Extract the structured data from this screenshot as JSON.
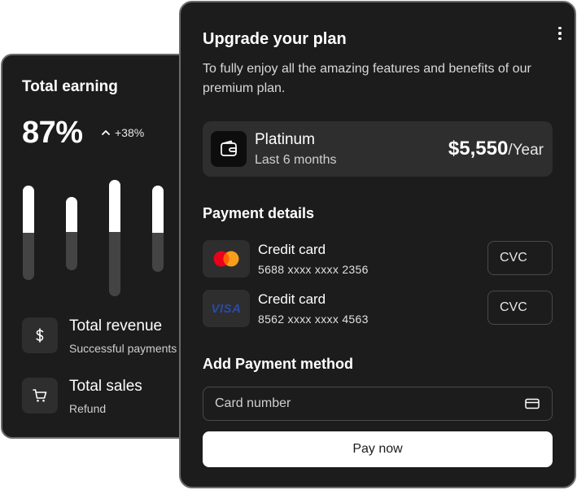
{
  "earnings": {
    "title": "Total earning",
    "percent": "87%",
    "change": "+38%",
    "bars": [
      {
        "level": 0.5
      },
      {
        "level": 0.48
      },
      {
        "level": 0.45
      },
      {
        "level": 0.55
      }
    ],
    "rows": [
      {
        "icon": "dollar-icon",
        "name": "Total revenue",
        "sub": "Successful payments"
      },
      {
        "icon": "cart-icon",
        "name": "Total sales",
        "sub": "Refund"
      }
    ]
  },
  "upgrade": {
    "title": "Upgrade your plan",
    "description": "To fully enjoy all the amazing features and benefits of our premium plan.",
    "menu_icon": "more-vertical-icon",
    "plan": {
      "icon": "wallet-icon",
      "name": "Platinum",
      "period": "Last 6 months",
      "amount": "$5,550",
      "unit": "/Year"
    },
    "payment_details_title": "Payment details",
    "methods": [
      {
        "brand": "mastercard",
        "name": "Credit card",
        "number": "5688 xxxx xxxx 2356",
        "cvc_placeholder": "CVC"
      },
      {
        "brand": "visa",
        "brand_label": "VISA",
        "name": "Credit card",
        "number": "8562 xxxx xxxx 4563",
        "cvc_placeholder": "CVC"
      }
    ],
    "add_method_title": "Add Payment method",
    "card_number_placeholder": "Card number",
    "pay_button": "Pay now"
  },
  "colors": {
    "card_bg": "#1c1c1c",
    "panel_bg": "#2e2e2e",
    "border": "#6b6b6b",
    "accent": "#ffffff",
    "mastercard_red": "#eb001b",
    "mastercard_orange": "#f79e1b"
  }
}
